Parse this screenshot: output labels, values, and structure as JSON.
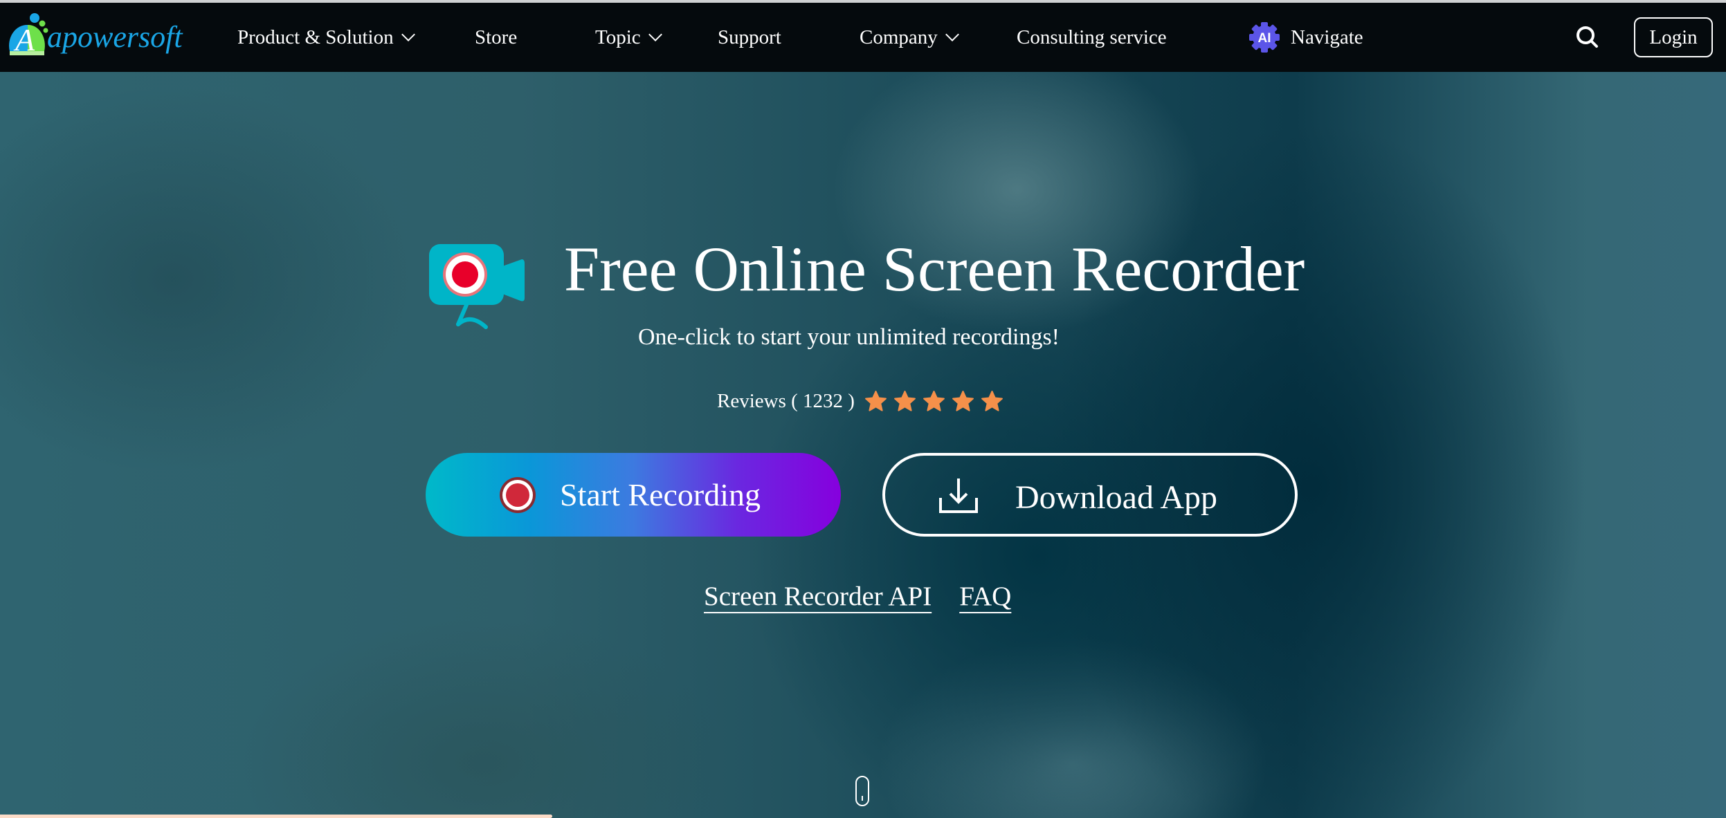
{
  "brand": {
    "logo_letter": "A",
    "name": "apowersoft",
    "colors": {
      "logo_text": "#1aa6e6",
      "logo_circle_blue": "#1aa6e6",
      "logo_circle_green": "#6ee04a"
    }
  },
  "nav": {
    "items": [
      {
        "label": "Product & Solution",
        "has_dropdown": true
      },
      {
        "label": "Store",
        "has_dropdown": false
      },
      {
        "label": "Topic",
        "has_dropdown": true
      },
      {
        "label": "Support",
        "has_dropdown": false
      },
      {
        "label": "Company",
        "has_dropdown": true
      },
      {
        "label": "Consulting service",
        "has_dropdown": false
      }
    ],
    "ai_badge": "AI",
    "ai_label": "Navigate",
    "search_icon": "search-icon",
    "login_label": "Login",
    "colors": {
      "background": "#050a0d",
      "ai_badge": "#5b55e8"
    }
  },
  "hero": {
    "title": "Free Online Screen Recorder",
    "subtitle": "One-click to start your unlimited recordings!",
    "reviews_label": "Reviews ( 1232 )",
    "reviews_count": 1232,
    "rating": {
      "value": 5,
      "max": 5
    },
    "start_button_label": "Start Recording",
    "download_button_label": "Download App",
    "links": [
      {
        "label": "Screen Recorder API"
      },
      {
        "label": "FAQ"
      }
    ],
    "colors": {
      "star": "#f5904a",
      "start_gradient_from": "#00b9c9",
      "start_gradient_to": "#8600de",
      "record_dot": "#e8002a",
      "camera_icon": "#00b5c8"
    }
  },
  "page_progress": {
    "fraction": 0.32,
    "color": "#fcdcc8"
  }
}
